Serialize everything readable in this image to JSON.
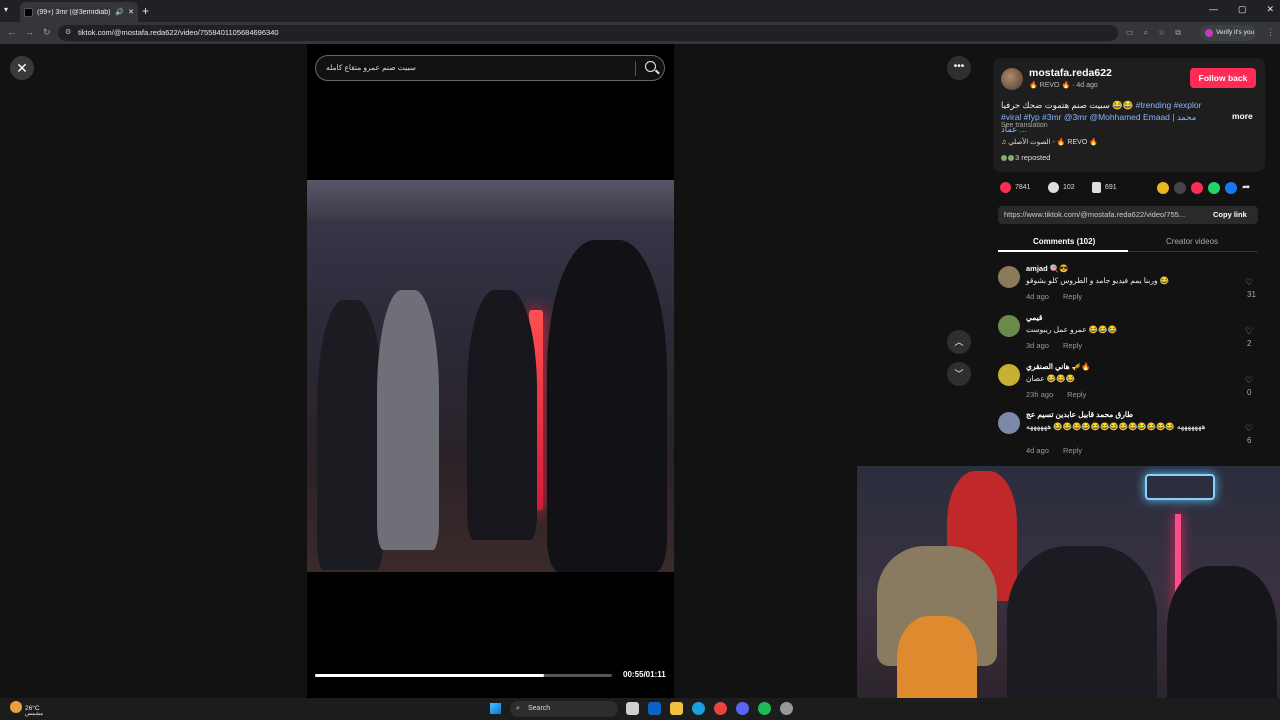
{
  "browser": {
    "tab_title": "(99+) 3mr (@3emrdiab) | TikTok",
    "new_tab": "+",
    "url": "tiktok.com/@mostafa.reda622/video/7558401105684696340",
    "verify_label": "Verify it's you"
  },
  "player": {
    "search_placeholder": "سبيت صنم عمرو متقاع كامله",
    "time": "00:55/01:11",
    "progress_fraction": 0.77
  },
  "post": {
    "username": "mostafa.reda622",
    "subtitle": "🔥 REVO 🔥 · 4d ago",
    "follow_label": "Follow back",
    "caption_text": "سبيت صنم هتموت ضحك حرفيا 😂😂",
    "caption_tags": "#trending #explor #viral #fyp #3mr @3mr @Mohhamed Emaad | محمد عماد ...",
    "more_label": "more",
    "see_translation": "See translation",
    "music": "♫  الصوت الأصلي - 🔥 REVO 🔥",
    "reposted": "3 reposted"
  },
  "stats": {
    "likes": "7841",
    "comments": "102",
    "saves": "691"
  },
  "link": {
    "url": "https://www.tiktok.com/@mostafa.reda622/video/755...",
    "copy_label": "Copy link"
  },
  "tabs": {
    "comments": "Comments (102)",
    "creator": "Creator videos"
  },
  "comments": [
    {
      "name": "amjad 🍭😎",
      "text": "وربنا يمم فيديو جامد و الطروس كلو بشوقو 😂",
      "time": "4d ago",
      "reply": "Reply",
      "likes": "31",
      "color": "#8a7a5a"
    },
    {
      "name": "قيمي",
      "text": "عمرو عمل ريبوست 😂😂😂",
      "time": "3d ago",
      "reply": "Reply",
      "likes": "2",
      "color": "#6a8a4a"
    },
    {
      "name": "هاني الصنقري 🎺🔥",
      "text": "عصان 😂😂😂",
      "time": "23h ago",
      "reply": "Reply",
      "likes": "0",
      "color": "#c8b030"
    },
    {
      "name": "طارق محمد قابيل عابدين تسيم عج",
      "text": "هههههههه 😂😂😂😂😂😂😂😂😂😂😂😂😂 ههههههه",
      "time": "4d ago",
      "reply": "Reply",
      "likes": "6",
      "color": "#7a8aa8"
    }
  ],
  "taskbar": {
    "temp": "26°C",
    "weather": "مشمس",
    "search": "Search"
  },
  "colors": {
    "accent": "#fe2c55",
    "tag": "#8ab4ff"
  }
}
